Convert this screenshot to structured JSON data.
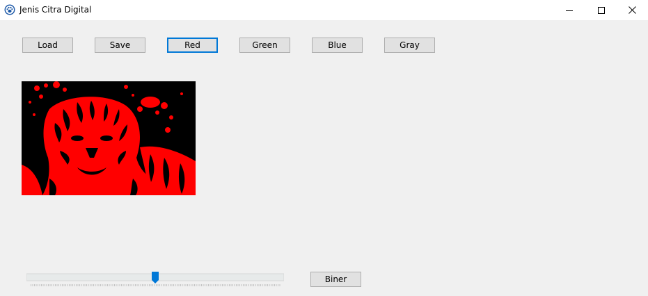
{
  "window": {
    "title": "Jenis Citra Digital",
    "icon": "paw-icon",
    "controls": [
      "minimize-icon",
      "maximize-icon",
      "close-icon"
    ]
  },
  "toolbar": {
    "buttons": [
      {
        "label": "Load"
      },
      {
        "label": "Save"
      },
      {
        "label": "Red",
        "focused": true
      },
      {
        "label": "Green"
      },
      {
        "label": "Blue"
      },
      {
        "label": "Gray"
      }
    ]
  },
  "picture": {
    "content": "tiger image, red channel",
    "colors": {
      "background": "#000000",
      "foreground": "#ff0000"
    }
  },
  "threshold_slider": {
    "value_fraction": 0.5
  },
  "biner_button": {
    "label": "Biner"
  },
  "colors": {
    "accent": "#0078d7",
    "button_face": "#e1e1e1",
    "window_bg": "#f0f0f0"
  }
}
